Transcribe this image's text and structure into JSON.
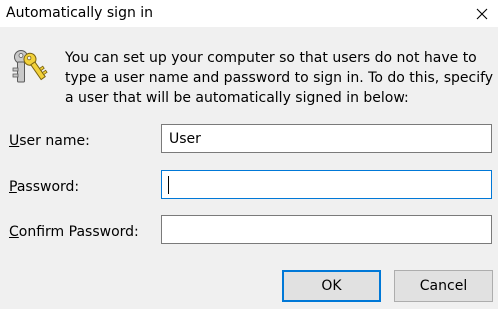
{
  "window": {
    "title": "Automatically sign in",
    "close_glyph": "✕"
  },
  "icon": {
    "name": "keys-icon"
  },
  "description": "You can set up your computer so that users do not have to type a user name and password to sign in. To do this, specify a user that will be automatically signed in below:",
  "form": {
    "username": {
      "label_accesskey": "U",
      "label_rest": "ser name:",
      "value": "User"
    },
    "password": {
      "label_accesskey": "P",
      "label_rest": "assword:",
      "value": ""
    },
    "confirm": {
      "label_accesskey": "C",
      "label_rest": "onfirm Password:",
      "value": ""
    }
  },
  "buttons": {
    "ok": "OK",
    "cancel": "Cancel"
  },
  "colors": {
    "accent": "#0078d7",
    "dialog_bg": "#f0f0f0",
    "button_bg": "#e1e1e1"
  }
}
